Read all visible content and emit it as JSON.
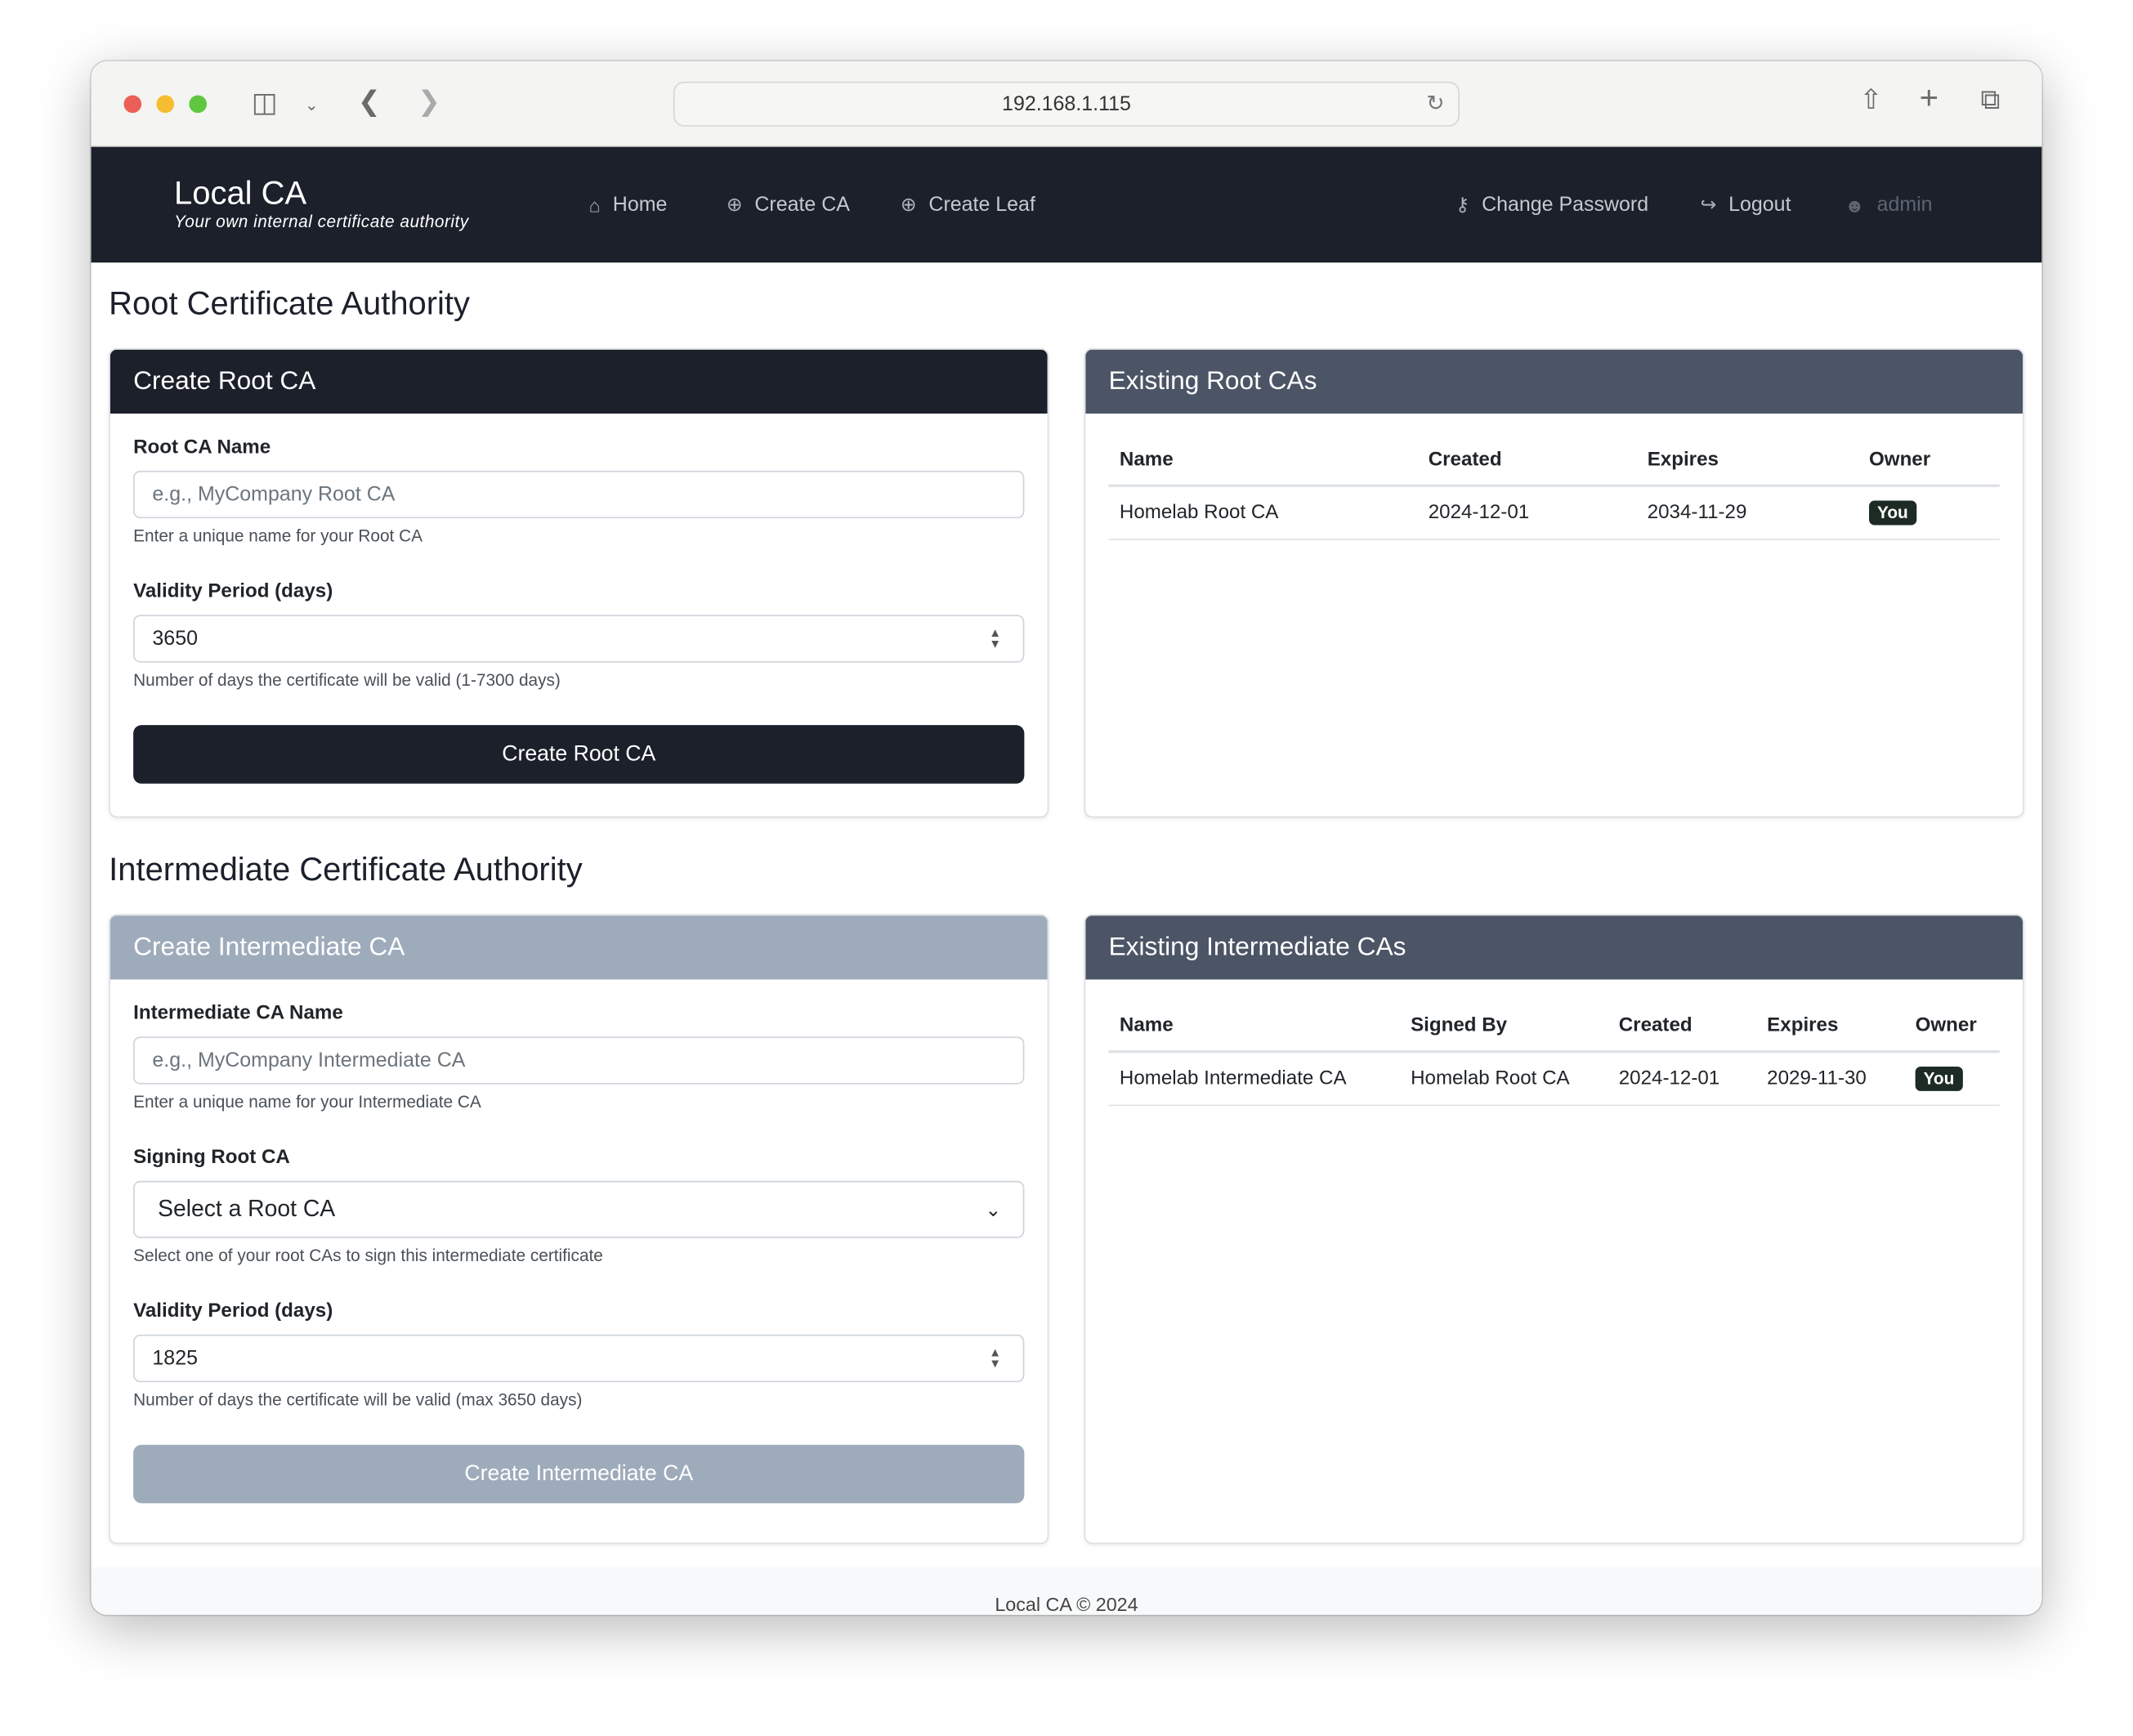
{
  "browser": {
    "url": "192.168.1.115"
  },
  "nav": {
    "brand": "Local CA",
    "tagline": "Your own internal certificate authority",
    "links": [
      {
        "label": "Home",
        "icon": "home-icon"
      },
      {
        "label": "Create CA",
        "icon": "plus-circle-icon"
      },
      {
        "label": "Create Leaf",
        "icon": "plus-circle-icon"
      }
    ],
    "right": [
      {
        "label": "Change Password",
        "icon": "key-icon"
      },
      {
        "label": "Logout",
        "icon": "logout-icon"
      },
      {
        "label": "admin",
        "icon": "user-icon"
      }
    ]
  },
  "root": {
    "heading": "Root Certificate Authority",
    "form": {
      "title": "Create Root CA",
      "name_label": "Root CA Name",
      "name_placeholder": "e.g., MyCompany Root CA",
      "name_help": "Enter a unique name for your Root CA",
      "validity_label": "Validity Period (days)",
      "validity_value": "3650",
      "validity_help": "Number of days the certificate will be valid (1-7300 days)",
      "submit": "Create Root CA"
    },
    "list": {
      "title": "Existing Root CAs",
      "columns": [
        "Name",
        "Created",
        "Expires",
        "Owner"
      ],
      "rows": [
        {
          "name": "Homelab Root CA",
          "created": "2024-12-01",
          "expires": "2034-11-29",
          "owner": "You"
        }
      ]
    }
  },
  "intermediate": {
    "heading": "Intermediate Certificate Authority",
    "form": {
      "title": "Create Intermediate CA",
      "name_label": "Intermediate CA Name",
      "name_placeholder": "e.g., MyCompany Intermediate CA",
      "name_help": "Enter a unique name for your Intermediate CA",
      "signing_label": "Signing Root CA",
      "signing_value": "Select a Root CA",
      "signing_help": "Select one of your root CAs to sign this intermediate certificate",
      "validity_label": "Validity Period (days)",
      "validity_value": "1825",
      "validity_help": "Number of days the certificate will be valid (max 3650 days)",
      "submit": "Create Intermediate CA"
    },
    "list": {
      "title": "Existing Intermediate CAs",
      "columns": [
        "Name",
        "Signed By",
        "Created",
        "Expires",
        "Owner"
      ],
      "rows": [
        {
          "name": "Homelab Intermediate CA",
          "signed_by": "Homelab Root CA",
          "created": "2024-12-01",
          "expires": "2029-11-30",
          "owner": "You"
        }
      ]
    }
  },
  "footer": "Local CA © 2024",
  "colors": {
    "navbar": "#1b202b",
    "card_header_dark": "#1b202b",
    "card_header_slate": "#4c5566",
    "disabled": "#9eabbb",
    "badge": "#1d2b24"
  }
}
